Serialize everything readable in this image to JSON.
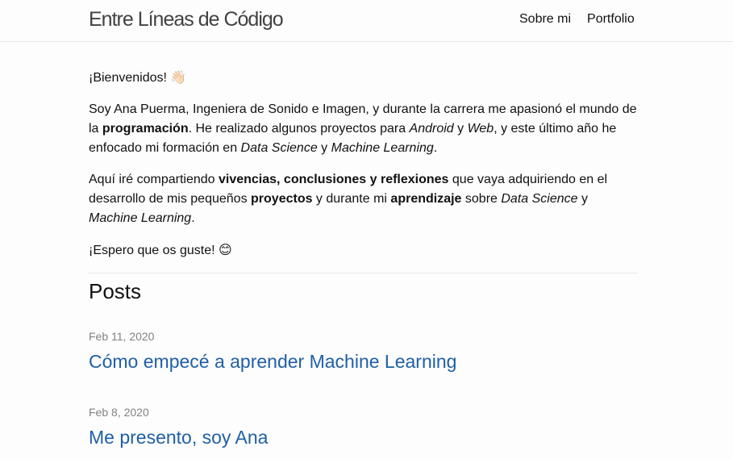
{
  "header": {
    "site_title": "Entre Líneas de Código",
    "nav": [
      {
        "label": "Sobre mi"
      },
      {
        "label": "Portfolio"
      }
    ]
  },
  "intro": {
    "greeting": "¡Bienvenidos!",
    "greeting_emoji": "👋🏻",
    "p1": {
      "t1": "Soy Ana Puerma, Ingeniera de Sonido e Imagen, y durante la carrera me apasionó el mundo de la ",
      "b1": "programación",
      "t2": ". He realizado algunos proyectos para ",
      "i1": "Android",
      "t3": " y ",
      "i2": "Web",
      "t4": ", y este último año he enfocado mi formación en ",
      "i3": "Data Science",
      "t5": " y ",
      "i4": "Machine Learning",
      "t6": "."
    },
    "p2": {
      "t1": "Aquí iré compartiendo ",
      "b1": "vivencias, conclusiones y reflexiones",
      "t2": " que vaya adquiriendo en el desarrollo de mis pequeños ",
      "b2": "proyectos",
      "t3": " y durante mi ",
      "b3": "aprendizaje",
      "t4": " sobre ",
      "i1": "Data Science",
      "t5": " y ",
      "i2": "Machine Learning",
      "t6": "."
    },
    "closing": "¡Espero que os guste!",
    "closing_emoji": "😊"
  },
  "posts": {
    "heading": "Posts",
    "items": [
      {
        "date": "Feb 11, 2020",
        "title": "Cómo empecé a aprender Machine Learning"
      },
      {
        "date": "Feb 8, 2020",
        "title": "Me presento, soy Ana"
      }
    ]
  },
  "colors": {
    "link": "#1f5fa6",
    "meta": "#828282",
    "title": "#424242"
  }
}
